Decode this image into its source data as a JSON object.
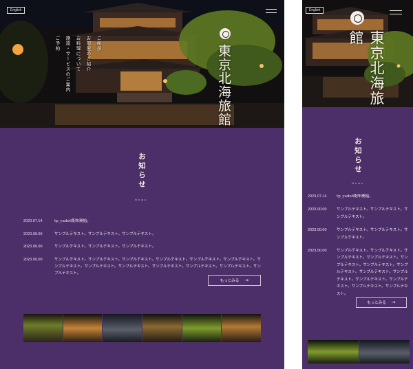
{
  "header": {
    "lang_label": "English",
    "logo_text": "東京北海旅館"
  },
  "nav": {
    "items": [
      "ご挨拶",
      "お部屋のご紹介",
      "お料理について",
      "施設・サービスのご案内",
      "ご予約"
    ]
  },
  "news": {
    "title": "お知らせ",
    "subtitle": "News",
    "items": [
      {
        "date": "2023.07.14",
        "text": "tp_yado6配布開始。"
      },
      {
        "date": "2023.00.00",
        "text": "サンプルテキスト。サンプルテキスト。サンプルテキスト。"
      },
      {
        "date": "2023.00.00",
        "text": "サンプルテキスト。サンプルテキスト。サンプルテキスト。"
      },
      {
        "date": "2023.00.00",
        "text": "サンプルテキスト。サンプルテキスト。サンプルテキスト。サンプルテキスト。サンプルテキスト。サンプルテキスト。サンプルテキスト。サンプルテキスト。サンプルテキスト。サンプルテキスト。サンプルテキスト。サンプルテキスト。サンプルテキスト。"
      }
    ],
    "more_label": "もっとみる",
    "more_arrow": "→"
  },
  "icons": {
    "menu": "hamburger-icon",
    "crest": "family-crest-icon",
    "arrow": "arrow-right-icon"
  },
  "colors": {
    "background": "#4c2f68",
    "text": "#f3ede6",
    "hero_dark": "#1b1612",
    "lantern": "#f3a340",
    "foliage": "#7f9c2c"
  }
}
